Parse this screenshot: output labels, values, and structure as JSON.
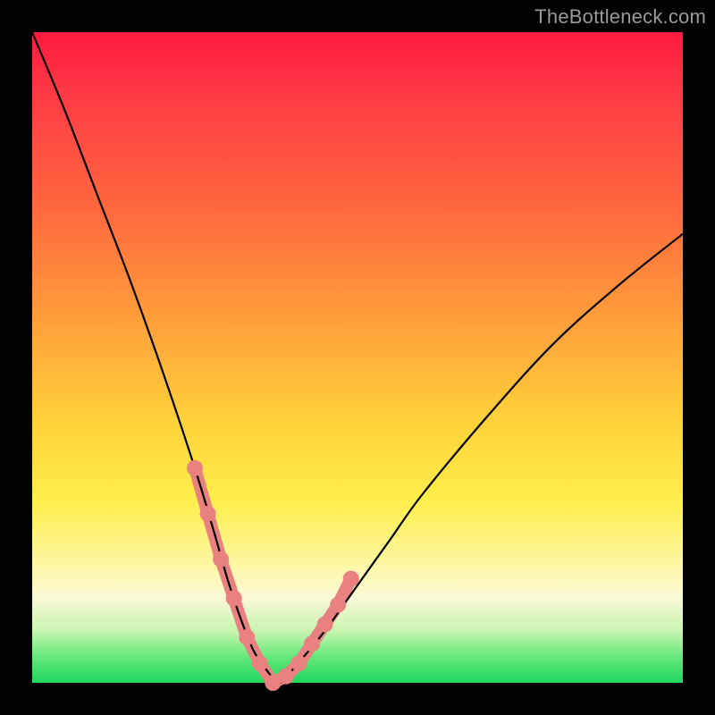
{
  "watermark": "TheBottleneck.com",
  "colors": {
    "black": "#000000",
    "pink": "#e8817f",
    "gradient_top": "#ff1a3f",
    "gradient_bottom": "#1fd65f"
  },
  "chart_data": {
    "type": "line",
    "title": "",
    "xlabel": "",
    "ylabel": "",
    "xlim": [
      0,
      100
    ],
    "ylim": [
      0,
      100
    ],
    "series": [
      {
        "name": "bottleneck-curve",
        "x": [
          0,
          5,
          10,
          15,
          20,
          25,
          28,
          30,
          32,
          34,
          36,
          38,
          40,
          45,
          50,
          55,
          60,
          70,
          80,
          90,
          100
        ],
        "y": [
          100,
          88,
          75,
          62,
          48,
          33,
          23,
          16,
          10,
          5,
          2,
          0,
          2,
          8,
          15,
          22,
          29,
          41,
          52,
          61,
          69
        ]
      }
    ],
    "highlight": {
      "name": "optimal-region",
      "x": [
        25,
        27,
        29,
        31,
        33,
        35,
        37,
        39,
        41,
        43,
        45,
        47,
        49
      ],
      "y": [
        33,
        26,
        19,
        13,
        7,
        3,
        0,
        1,
        3,
        6,
        9,
        12,
        16
      ]
    }
  }
}
